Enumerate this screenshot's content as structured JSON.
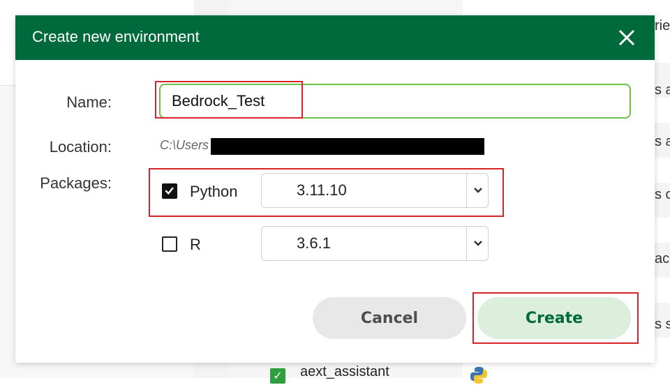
{
  "background": {
    "peek_texts": [
      "rie",
      "s a",
      "s a",
      "s c",
      "ack",
      "s s"
    ],
    "visible_row_label": "aext_assistant",
    "icons": [
      "checkbox-checked-icon",
      "python-logo-icon"
    ]
  },
  "dialog": {
    "title": "Create new environment",
    "close_icon": "close-icon",
    "name_label": "Name:",
    "name_value": "Bedrock_Test",
    "location_label": "Location:",
    "location_path": "C:\\Users",
    "packages_label": "Packages:",
    "packages": [
      {
        "name": "Python",
        "checked": true,
        "version": "3.11.10"
      },
      {
        "name": "R",
        "checked": false,
        "version": "3.6.1"
      }
    ],
    "cancel_label": "Cancel",
    "create_label": "Create"
  },
  "colors": {
    "header": "#006a3c",
    "input_border": "#6cc04a",
    "create_bg": "#dcefdc",
    "highlight": "#d9222a"
  }
}
